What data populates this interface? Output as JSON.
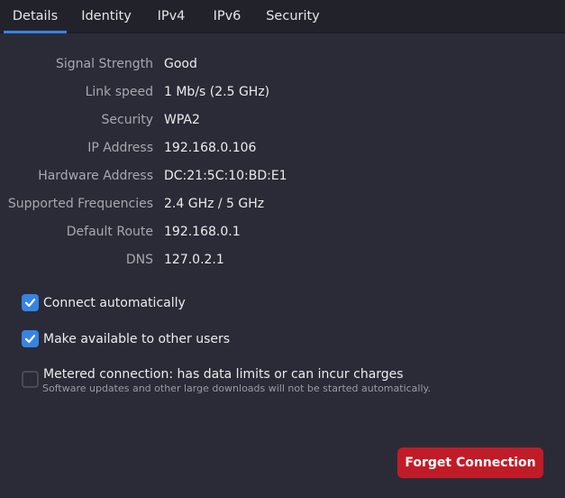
{
  "tabs": {
    "details": "Details",
    "identity": "Identity",
    "ipv4": "IPv4",
    "ipv6": "IPv6",
    "security": "Security"
  },
  "details": {
    "signal_strength": {
      "label": "Signal Strength",
      "value": "Good"
    },
    "link_speed": {
      "label": "Link speed",
      "value": "1 Mb/s (2.5 GHz)"
    },
    "security": {
      "label": "Security",
      "value": "WPA2"
    },
    "ip_address": {
      "label": "IP Address",
      "value": "192.168.0.106"
    },
    "hardware_address": {
      "label": "Hardware Address",
      "value": "DC:21:5C:10:BD:E1"
    },
    "supported_frequencies": {
      "label": "Supported Frequencies",
      "value": "2.4 GHz / 5 GHz"
    },
    "default_route": {
      "label": "Default Route",
      "value": "192.168.0.1"
    },
    "dns": {
      "label": "DNS",
      "value": "127.0.2.1"
    }
  },
  "options": {
    "connect_automatically": {
      "label": "Connect automatically",
      "checked": true
    },
    "available_to_others": {
      "label": "Make available to other users",
      "checked": true
    },
    "metered": {
      "label": "Metered connection: has data limits or can incur charges",
      "sublabel": "Software updates and other large downloads will not be started automatically.",
      "checked": false
    }
  },
  "actions": {
    "forget_label": "Forget Connection"
  },
  "colors": {
    "accent": "#3584e4",
    "destructive": "#c01c28",
    "background": "#2b2b37"
  }
}
